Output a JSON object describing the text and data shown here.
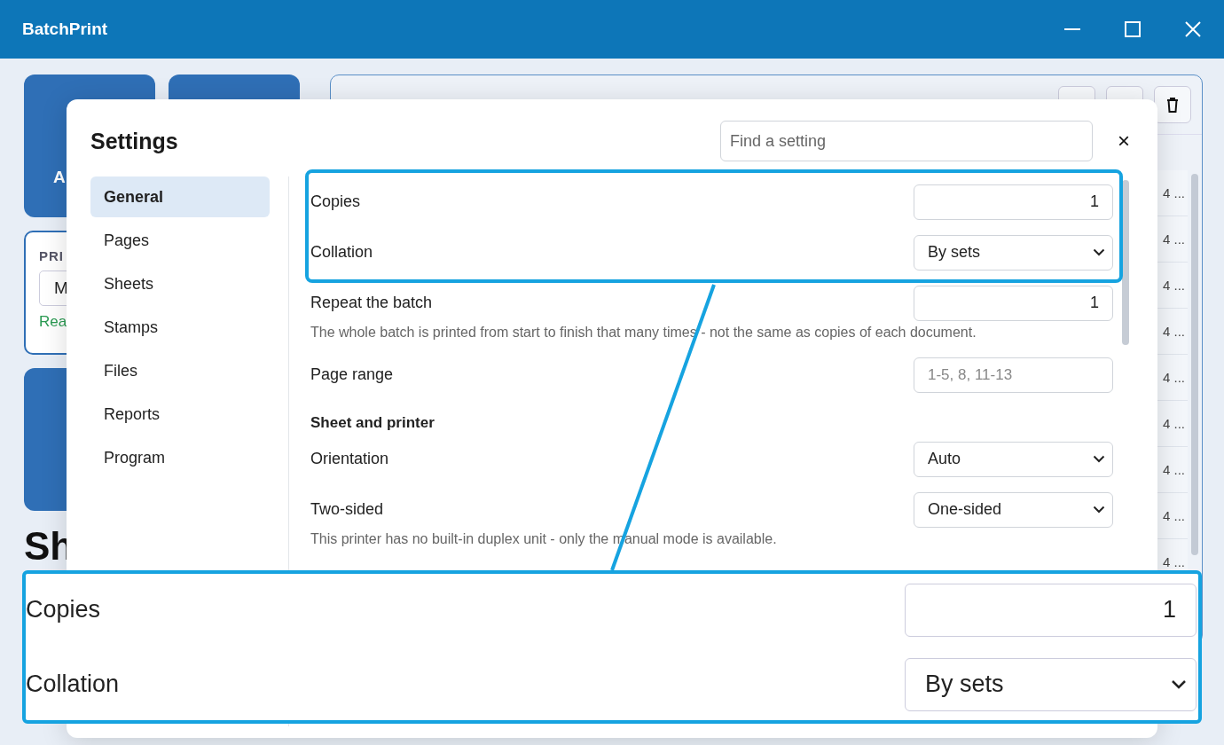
{
  "window": {
    "title": "BatchPrint"
  },
  "background": {
    "tile_label": "A",
    "printer_card": {
      "heading": "PRI",
      "value": "M",
      "status": "Rea"
    },
    "heading": "Sh",
    "document_cells": [
      "4 ...",
      "4 ...",
      "4 ...",
      "4 ...",
      "4 ...",
      "4 ...",
      "4 ...",
      "4 ...",
      "4 ..."
    ]
  },
  "dialog": {
    "title": "Settings",
    "search": {
      "placeholder": "Find a setting"
    },
    "close": "×",
    "nav": [
      {
        "label": "General",
        "selected": true
      },
      {
        "label": "Pages",
        "selected": false
      },
      {
        "label": "Sheets",
        "selected": false
      },
      {
        "label": "Stamps",
        "selected": false
      },
      {
        "label": "Files",
        "selected": false
      },
      {
        "label": "Reports",
        "selected": false
      },
      {
        "label": "Program",
        "selected": false
      }
    ],
    "rows": [
      {
        "kind": "number",
        "label": "Copies",
        "value": "1",
        "highlighted": true
      },
      {
        "kind": "select",
        "label": "Collation",
        "value": "By sets",
        "highlighted": true
      },
      {
        "kind": "number",
        "label": "Repeat the batch",
        "value": "1",
        "highlighted": false
      },
      {
        "kind": "hint",
        "text": "The whole batch is printed from start to finish that many times - not the same as copies of each document.",
        "highlighted": false
      },
      {
        "kind": "text",
        "label": "Page range",
        "placeholder": "1-5, 8, 11-13",
        "highlighted": false
      },
      {
        "kind": "section",
        "text": "Sheet and printer",
        "highlighted": false
      },
      {
        "kind": "select",
        "label": "Orientation",
        "value": "Auto",
        "highlighted": false
      },
      {
        "kind": "select",
        "label": "Two-sided",
        "value": "One-sided",
        "highlighted": false
      },
      {
        "kind": "hint",
        "text": "This printer has no built-in duplex unit - only the manual mode is available.",
        "highlighted": false
      }
    ]
  },
  "callout": {
    "rows": [
      {
        "kind": "number",
        "label": "Copies",
        "value": "1"
      },
      {
        "kind": "select",
        "label": "Collation",
        "value": "By sets"
      }
    ]
  }
}
